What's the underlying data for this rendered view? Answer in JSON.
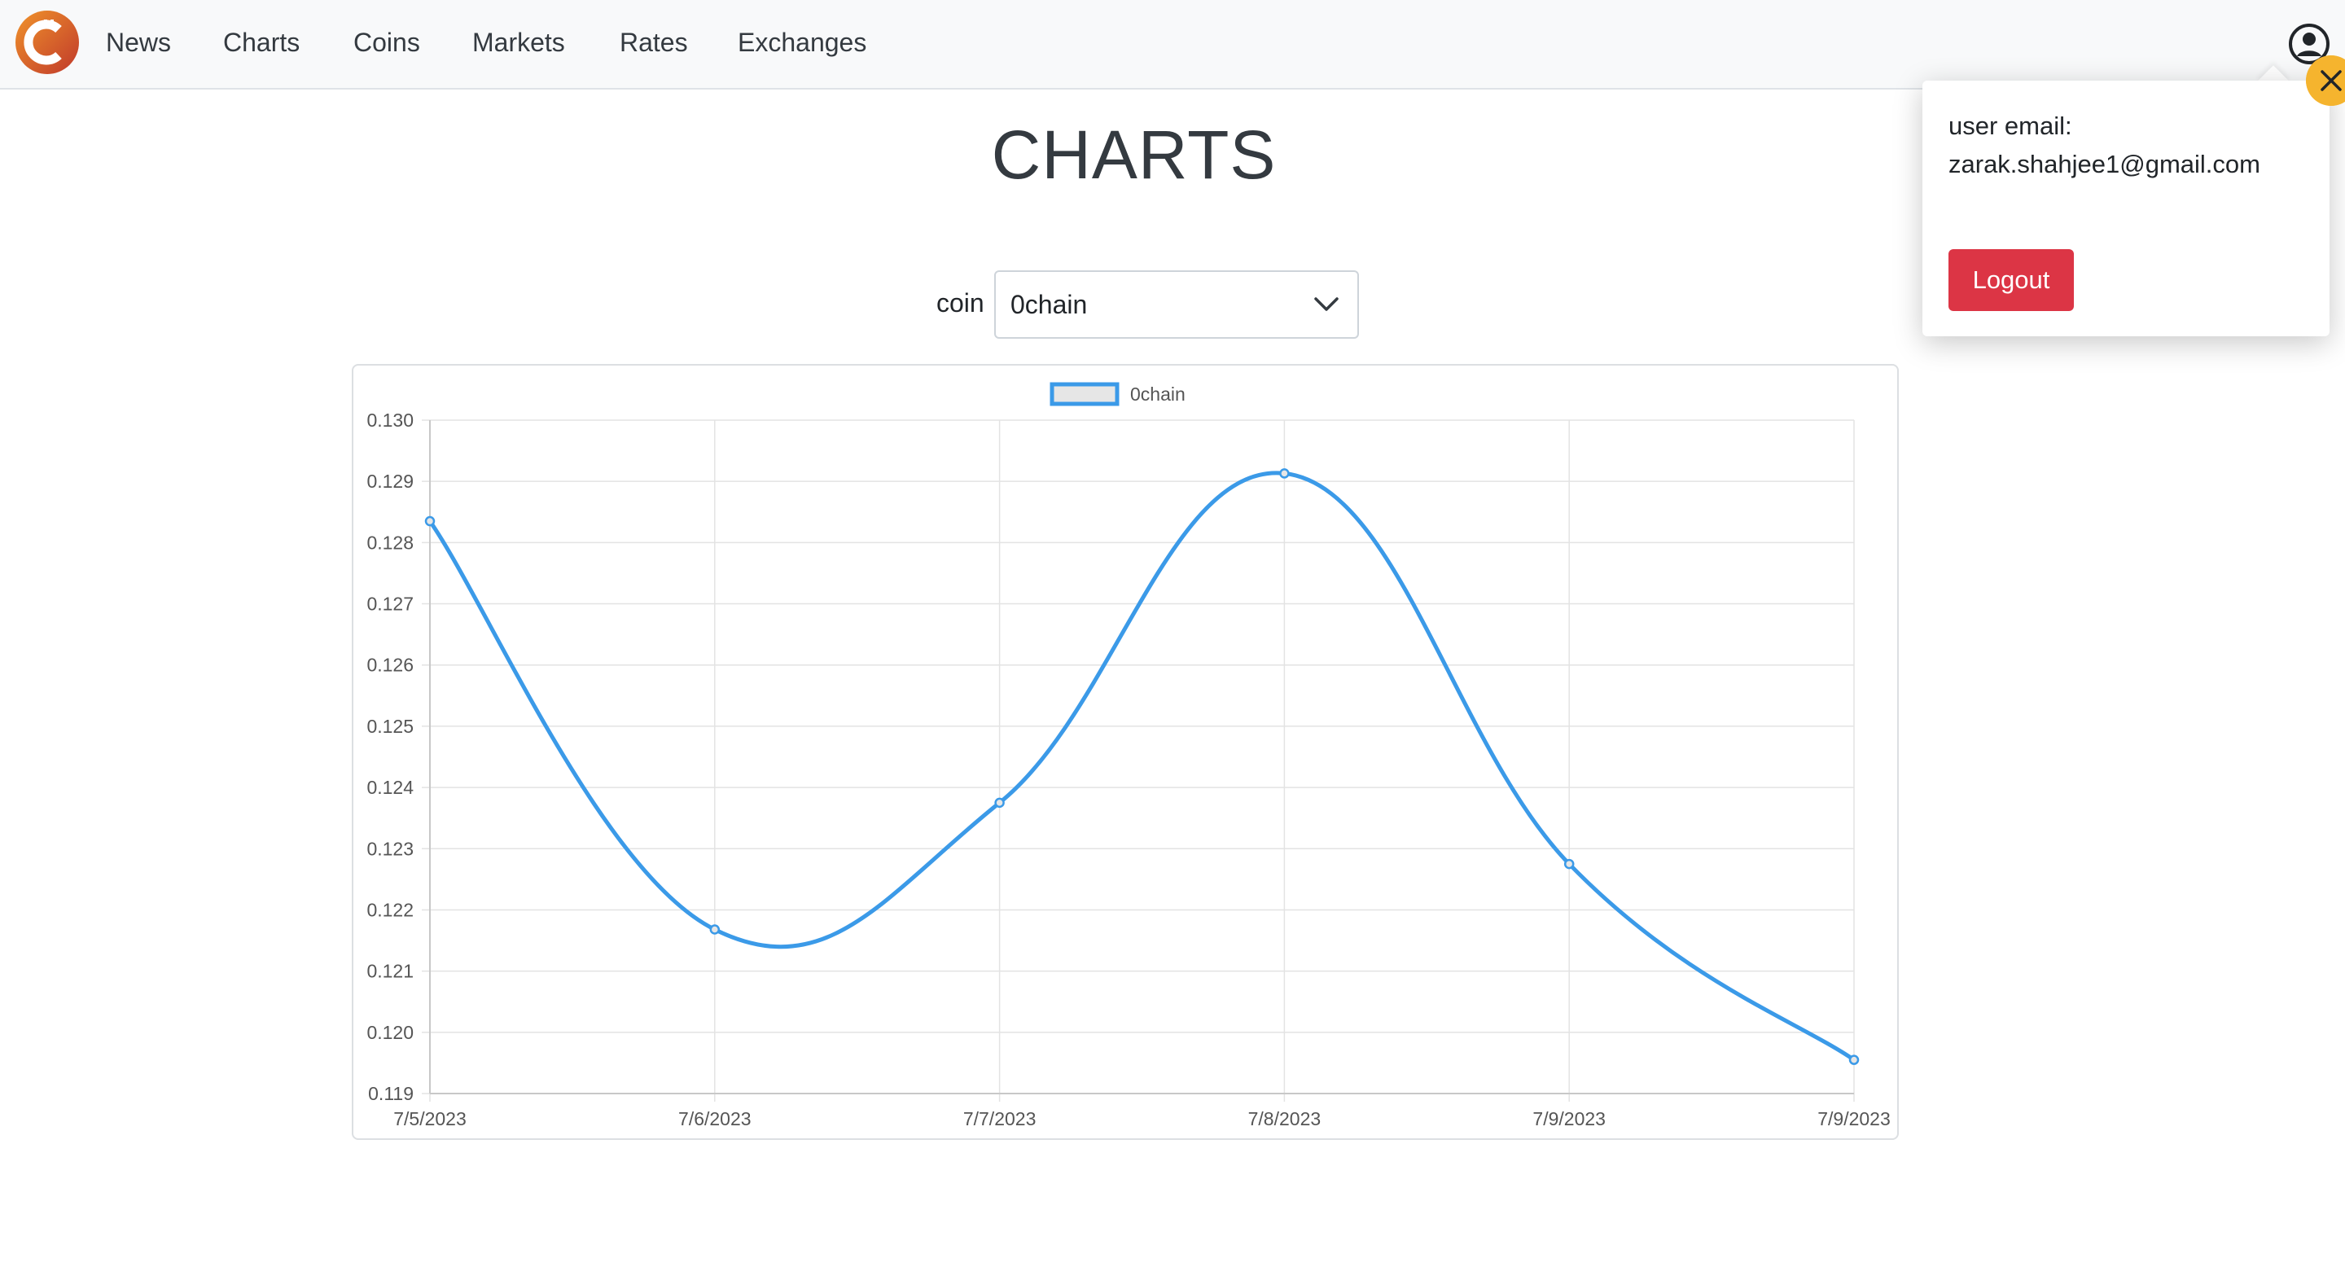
{
  "nav": {
    "items": [
      {
        "label": "News"
      },
      {
        "label": "Charts"
      },
      {
        "label": "Coins"
      },
      {
        "label": "Markets"
      },
      {
        "label": "Rates"
      },
      {
        "label": "Exchanges"
      }
    ],
    "logo_icon": "coin-c-logo-icon",
    "user_icon": "user-circle-icon"
  },
  "page": {
    "title": "CHARTS"
  },
  "coin_selector": {
    "label": "coin",
    "selected": "0chain",
    "chevron_icon": "chevron-down-icon"
  },
  "popover": {
    "email_label": "user email:",
    "email": "zarak.shahjee1@gmail.com",
    "logout_label": "Logout",
    "close_icon": "close-icon"
  },
  "colors": {
    "line": "#3b9ae8",
    "logout": "#dc3545",
    "close": "#f5b42e",
    "logo_from": "#f39c12",
    "logo_to": "#d63031"
  },
  "chart_data": {
    "type": "line",
    "categories": [
      "7/5/2023",
      "7/6/2023",
      "7/7/2023",
      "7/8/2023",
      "7/9/2023",
      "7/9/2023"
    ],
    "series": [
      {
        "name": "0chain",
        "values": [
          0.12835,
          0.12168,
          0.12375,
          0.12913,
          0.12275,
          0.11955
        ]
      }
    ],
    "yticks": [
      "0.130",
      "0.129",
      "0.128",
      "0.127",
      "0.126",
      "0.125",
      "0.124",
      "0.123",
      "0.122",
      "0.121",
      "0.120",
      "0.119"
    ],
    "ylim": [
      0.119,
      0.13
    ],
    "grid": true,
    "legend": "top-center"
  }
}
